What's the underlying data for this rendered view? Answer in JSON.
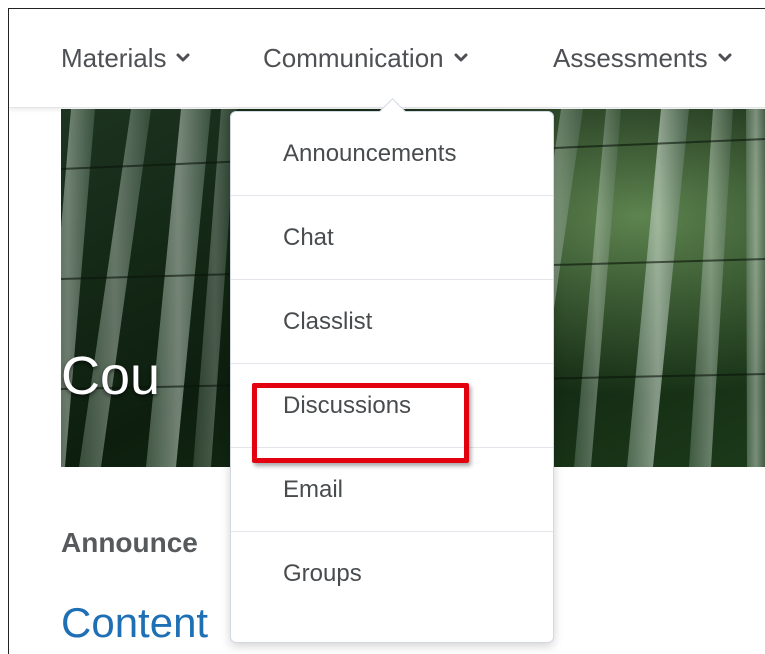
{
  "nav": {
    "items": [
      {
        "label": "Materials"
      },
      {
        "label": "Communication"
      },
      {
        "label": "Assessments"
      }
    ]
  },
  "banner": {
    "course_title": "Cou"
  },
  "page": {
    "widget_heading": "Announce",
    "content_link": "Content"
  },
  "dropdown": {
    "items": [
      {
        "label": "Announcements"
      },
      {
        "label": "Chat"
      },
      {
        "label": "Classlist"
      },
      {
        "label": "Discussions",
        "highlighted": true
      },
      {
        "label": "Email"
      },
      {
        "label": "Groups"
      }
    ]
  },
  "colors": {
    "highlight": "#e3000f",
    "link": "#1f6fb5",
    "text": "#494c4e"
  },
  "icons": {
    "nav_chevron": "chevron-down-icon"
  }
}
